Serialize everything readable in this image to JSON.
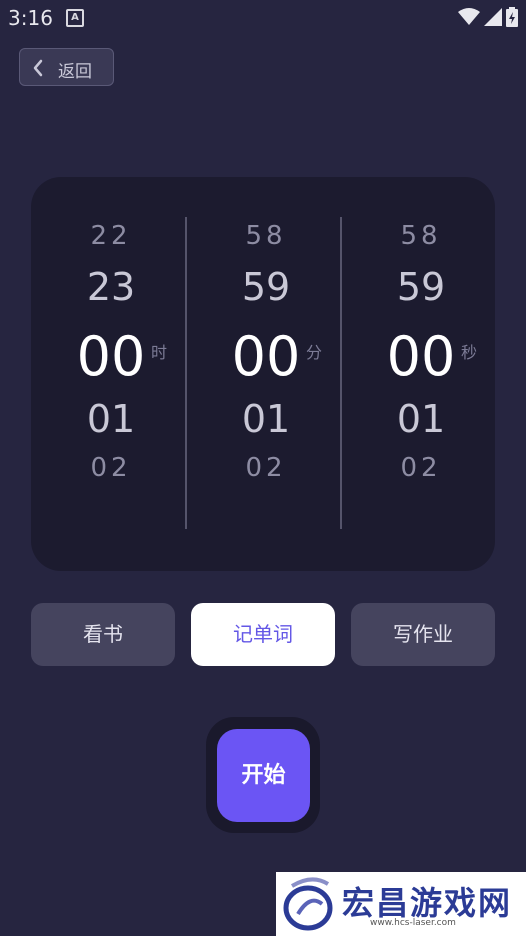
{
  "status_bar": {
    "time": "3:16",
    "notification_icon": "A"
  },
  "header": {
    "back_label": "返回"
  },
  "picker": {
    "hours": {
      "far_above": "22",
      "above": "23",
      "selected": "00",
      "below": "01",
      "far_below": "02",
      "unit": "时"
    },
    "minutes": {
      "far_above": "58",
      "above": "59",
      "selected": "00",
      "below": "01",
      "far_below": "02",
      "unit": "分"
    },
    "seconds": {
      "far_above": "58",
      "above": "59",
      "selected": "00",
      "below": "01",
      "far_below": "02",
      "unit": "秒"
    }
  },
  "tasks": [
    {
      "label": "看书",
      "active": false
    },
    {
      "label": "记单词",
      "active": true
    },
    {
      "label": "写作业",
      "active": false
    }
  ],
  "start_label": "开始",
  "watermark": {
    "text": "宏昌游戏网",
    "url": "www.hcs-laser.com"
  },
  "colors": {
    "background": "#262540",
    "card": "#1c1b2f",
    "accent": "#6b55f4",
    "active_task_text": "#6357e6"
  }
}
